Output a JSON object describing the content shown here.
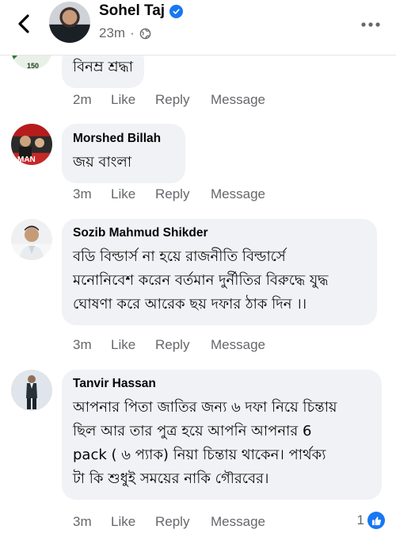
{
  "header": {
    "name": "Sohel Taj",
    "time": "23m",
    "separator": "·"
  },
  "comments": [
    {
      "author": "",
      "text": "বিনম্র শ্রদ্ধা",
      "time": "2m",
      "like": "Like",
      "reply": "Reply",
      "message": "Message"
    },
    {
      "author": "Morshed Billah",
      "text": "জয় বাংলা",
      "time": "3m",
      "like": "Like",
      "reply": "Reply",
      "message": "Message"
    },
    {
      "author": "Sozib Mahmud Shikder",
      "lines": [
        "বডি বিল্ডার্স না হয়ে রাজনীতি বিল্ডার্সে",
        "মনোনিবেশ করেন বর্তমান দুর্নীতির বিরুদ্ধে যুদ্ধ",
        "ঘোষণা করে আরেক ছয় দফার ঠাক দিন ।।"
      ],
      "time": "3m",
      "like": "Like",
      "reply": "Reply",
      "message": "Message"
    },
    {
      "author": "Tanvir Hassan",
      "lines": [
        "আপনার পিতা জাতির জন্য ৬ দফা নিয়ে চিন্তায়",
        "ছিল আর তার পুত্র হয়ে আপনি আপনার 6",
        "pack ( ৬ প্যাক) নিয়া চিন্তায় থাকেন। পার্থক্য",
        "টা কি শুধুই সময়ের নাকি গৌরবের।"
      ],
      "time": "3m",
      "like": "Like",
      "reply": "Reply",
      "message": "Message",
      "reaction_count": "1"
    }
  ],
  "colors": {
    "accent": "#1877f2",
    "bubble": "#f0f2f5",
    "secondary_text": "#65676b"
  },
  "icons": {
    "back": "chevron-left-icon",
    "verified": "verified-badge-icon",
    "privacy": "globe-icon",
    "more": "more-horizontal-icon",
    "reaction": "thumbs-up-icon"
  }
}
